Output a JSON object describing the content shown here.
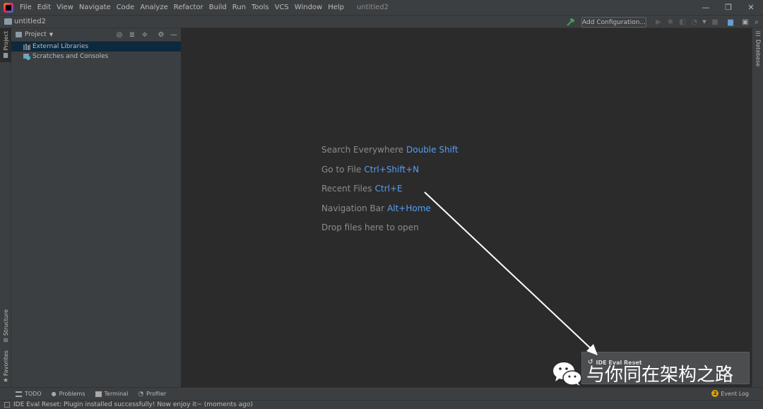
{
  "menubar": {
    "items": [
      "File",
      "Edit",
      "View",
      "Navigate",
      "Code",
      "Analyze",
      "Refactor",
      "Build",
      "Run",
      "Tools",
      "VCS",
      "Window",
      "Help"
    ],
    "window_title": "untitled2",
    "minimize": "—",
    "restore": "❐",
    "close": "✕"
  },
  "navbar": {
    "project_name": "untitled2",
    "add_configuration": "Add Configuration..."
  },
  "left_tabs": {
    "project": "Project",
    "structure": "Structure",
    "favorites": "Favorites"
  },
  "project_panel": {
    "title": "Project",
    "items": [
      {
        "label": "External Libraries",
        "icon": "library-icon",
        "selected": true
      },
      {
        "label": "Scratches and Consoles",
        "icon": "scratches-icon",
        "selected": false
      }
    ]
  },
  "editor": {
    "hints": [
      {
        "text": "Search Everywhere",
        "shortcut": "Double Shift"
      },
      {
        "text": "Go to File",
        "shortcut": "Ctrl+Shift+N"
      },
      {
        "text": "Recent Files",
        "shortcut": "Ctrl+E"
      },
      {
        "text": "Navigation Bar",
        "shortcut": "Alt+Home"
      },
      {
        "text": "Drop files here to open",
        "shortcut": ""
      }
    ]
  },
  "right_tabs": {
    "database": "Database"
  },
  "notification": {
    "title": "IDE Eval Reset",
    "body": "Plugin installed successfully! Now enjoy it~"
  },
  "watermark": {
    "text": "与你同在架构之路"
  },
  "bottom_tools": {
    "items": [
      {
        "label": "TODO",
        "icon": "list-icon"
      },
      {
        "label": "Problems",
        "icon": "info-icon"
      },
      {
        "label": "Terminal",
        "icon": "terminal-icon"
      },
      {
        "label": "Profiler",
        "icon": "profiler-icon"
      }
    ],
    "event_log": "Event Log",
    "event_count": "2"
  },
  "statusbar": {
    "text": "IDE Eval Reset: Plugin installed successfully! Now enjoy it~ (moments ago)"
  },
  "colors": {
    "background": "#2b2b2b",
    "panel": "#3c3f41",
    "shortcut": "#589df6",
    "selection": "#0d293e"
  }
}
